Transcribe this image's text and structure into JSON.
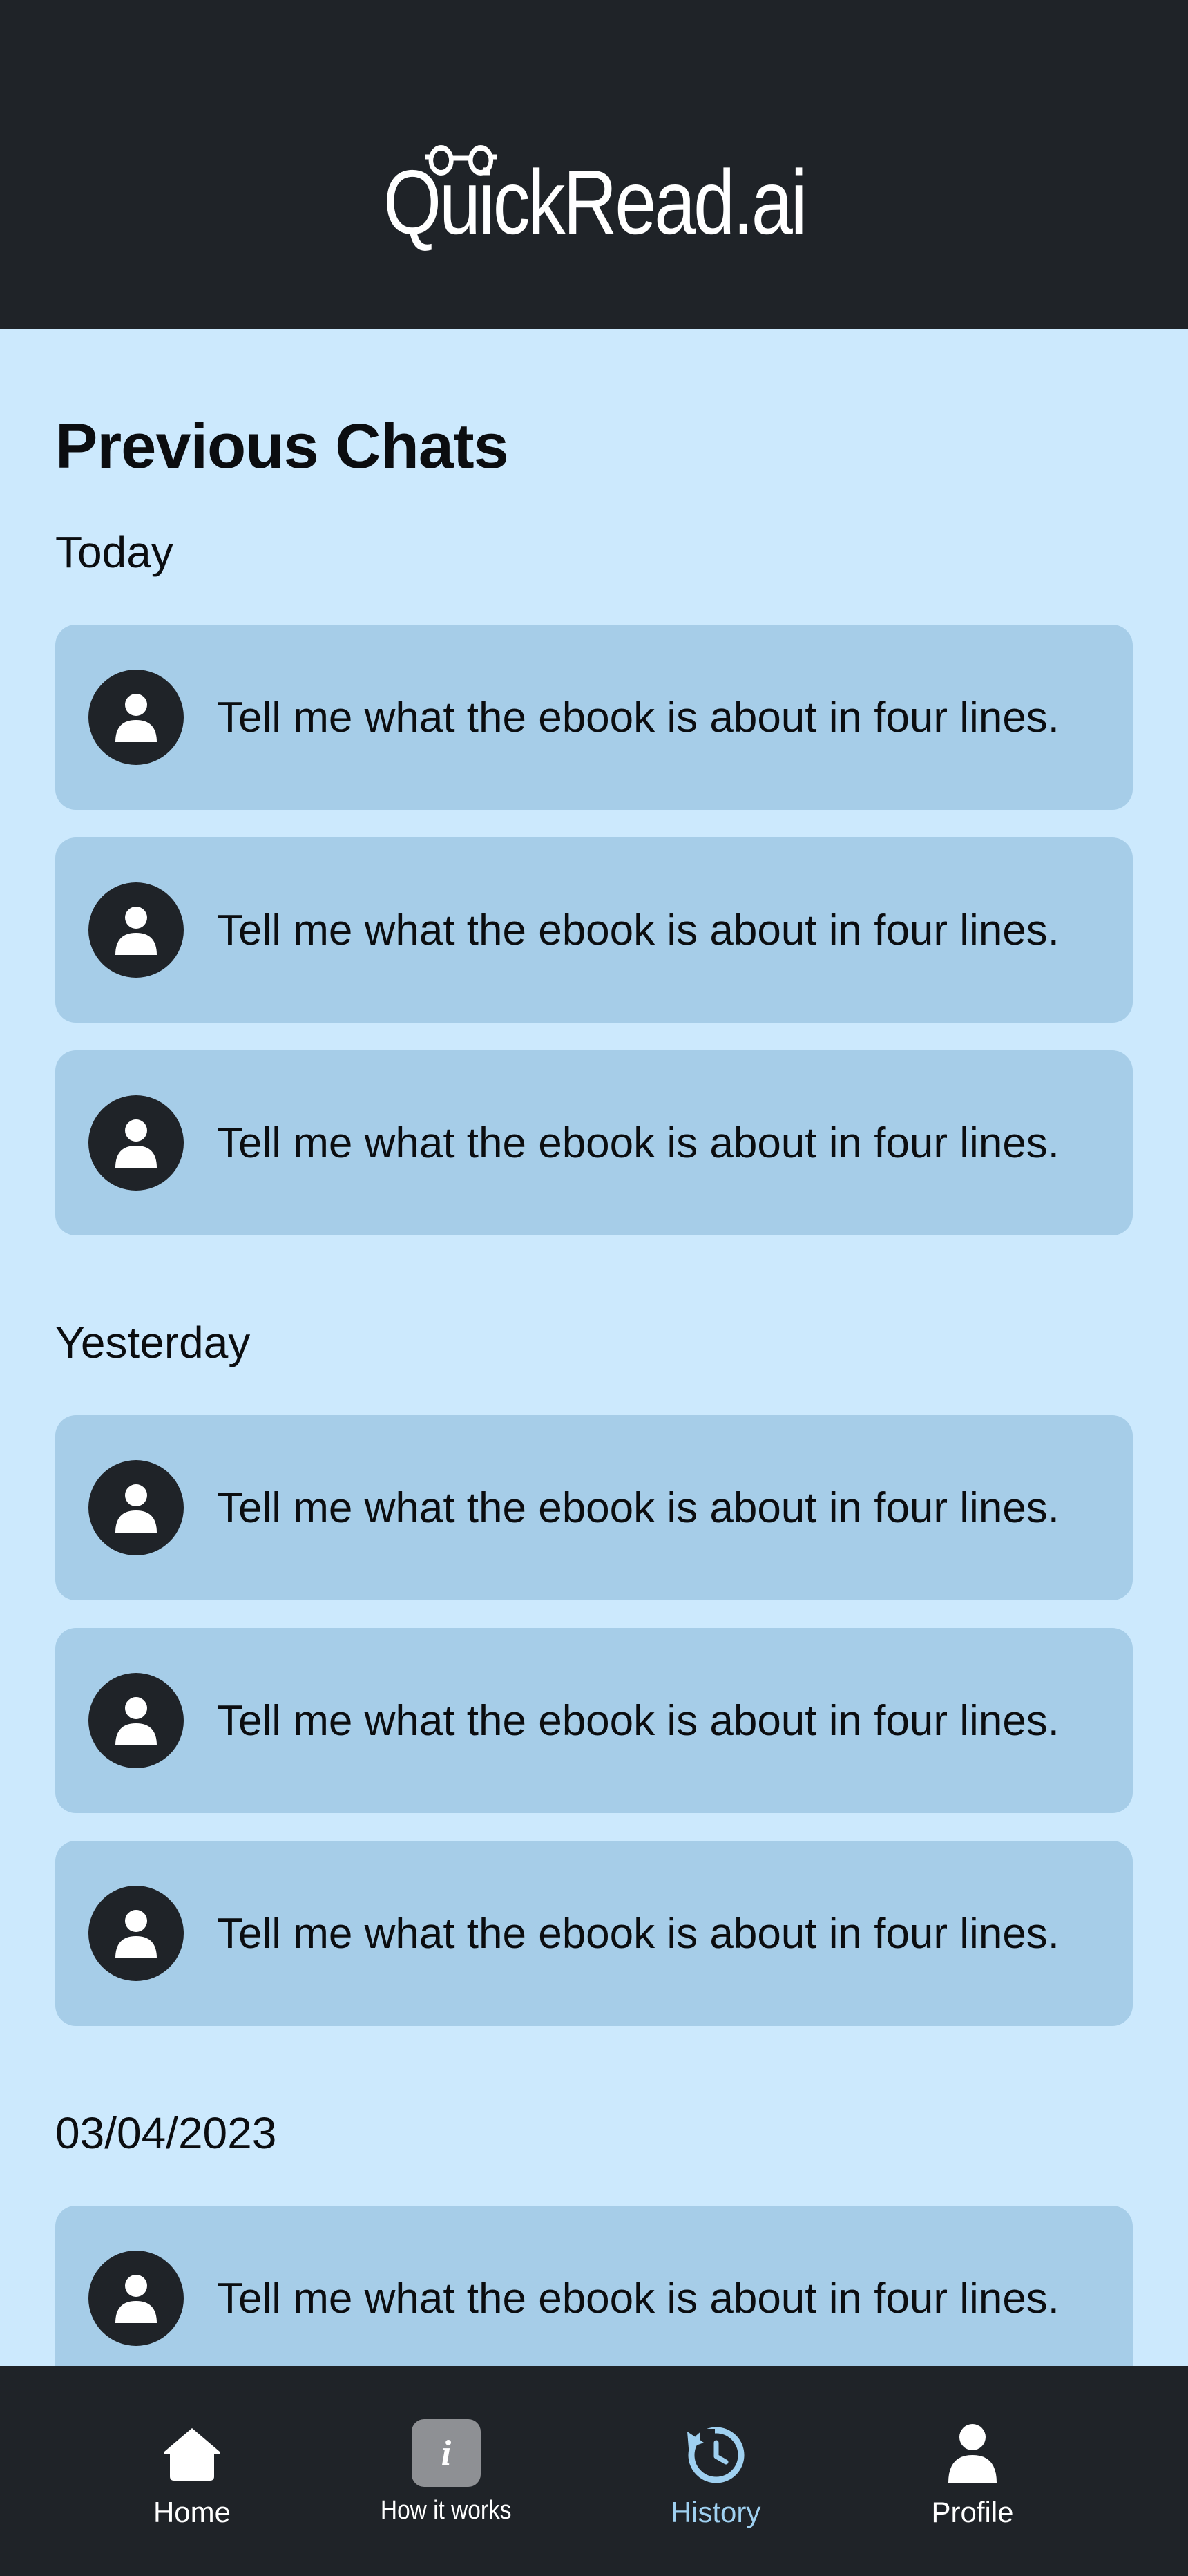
{
  "header": {
    "brand": "QuickRead.ai"
  },
  "page": {
    "title": "Previous Chats"
  },
  "sections": [
    {
      "label": "Today",
      "chats": [
        {
          "text": "Tell me what the ebook is about in four lines."
        },
        {
          "text": "Tell me what the ebook is about in four lines."
        },
        {
          "text": "Tell me what the ebook is about in four lines."
        }
      ]
    },
    {
      "label": "Yesterday",
      "chats": [
        {
          "text": "Tell me what the ebook is about in four lines."
        },
        {
          "text": "Tell me what the ebook is about in four lines."
        },
        {
          "text": "Tell me what the ebook is about in four lines."
        }
      ]
    },
    {
      "label": "03/04/2023",
      "chats": [
        {
          "text": "Tell me what the ebook is about in four lines."
        }
      ]
    }
  ],
  "nav": {
    "items": [
      {
        "label": "Home",
        "icon": "home-icon"
      },
      {
        "label": "How it works",
        "icon": "info-icon"
      },
      {
        "label": "History",
        "icon": "history-icon",
        "active": true
      },
      {
        "label": "Profile",
        "icon": "user-icon"
      }
    ]
  },
  "colors": {
    "background": "#cce9fd",
    "header": "#1f2328",
    "card": "#a6cde8",
    "active_nav": "#9fd0f0"
  }
}
